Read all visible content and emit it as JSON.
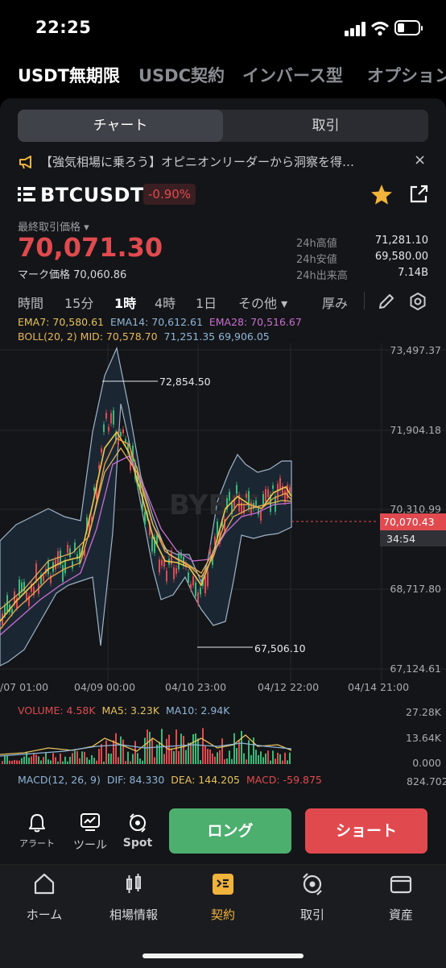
{
  "status": {
    "time": "22:25"
  },
  "market_tabs": [
    "USDT無期限",
    "USDC契約",
    "インバース型",
    "オプション"
  ],
  "segment": {
    "chart": "チャート",
    "trade": "取引"
  },
  "banner": {
    "text": "【強気相場に乗ろう】オピニオンリーダーから洞察を得…",
    "close": "×"
  },
  "ticker": {
    "symbol": "BTCUSDT",
    "change": "-0.90%",
    "last_label": "最終取引価格 ▾",
    "last_price": "70,071.30",
    "mark_label": "マーク価格",
    "mark_price": "70,060.86",
    "stats": [
      {
        "k": "24h高値",
        "v": "71,281.10"
      },
      {
        "k": "24h安値",
        "v": "69,580.00"
      },
      {
        "k": "24h出来高",
        "v": "7.14B"
      }
    ]
  },
  "timeframes": {
    "time": "時間",
    "m15": "15分",
    "h1": "1時",
    "h4": "4時",
    "d1": "1日",
    "more": "その他 ▾",
    "depth": "厚み"
  },
  "indicators": {
    "ema7": "EMA7: 70,580.61",
    "ema14": "EMA14: 70,612.61",
    "ema28": "EMA28: 70,516.67",
    "boll_label": "BOLL(20, 2) MID: 70,578.70",
    "boll_up": "71,251.35",
    "boll_dn": "69,906.05"
  },
  "price_axis": [
    "73,497.37",
    "71,904.18",
    "70,310.99",
    "68,717.80",
    "67,124.61"
  ],
  "current_price_tag": "70,070.43",
  "countdown": "34:54",
  "annotations": {
    "high": "72,854.50",
    "low": "67,506.10"
  },
  "time_axis": [
    "/07 01:00",
    "04/09 00:00",
    "04/10 23:00",
    "04/12 22:00",
    "04/14 21:00"
  ],
  "volume": {
    "vol": "VOLUME: 4.58K",
    "ma5": "MA5: 3.23K",
    "ma10": "MA10: 2.94K",
    "axis": [
      "27.28K",
      "13.64K",
      "0.000"
    ]
  },
  "macd": {
    "label": "MACD(12, 26, 9)",
    "dif": "DIF: 84.330",
    "dea": "DEA: 144.205",
    "macd": "MACD: -59.875",
    "axis": "824.702"
  },
  "tools": {
    "alert": "アラート",
    "tool": "ツール",
    "spot": "Spot"
  },
  "actions": {
    "long": "ロング",
    "short": "ショート"
  },
  "nav": {
    "home": "ホーム",
    "market": "相場情報",
    "contract": "契約",
    "trade": "取引",
    "assets": "資産"
  },
  "watermark": "BYBIT",
  "colors": {
    "up": "#3cb878",
    "down": "#e04a4f",
    "accent": "#f0b33b",
    "long_btn": "#4caf6e",
    "short_btn": "#e04a4f"
  }
}
